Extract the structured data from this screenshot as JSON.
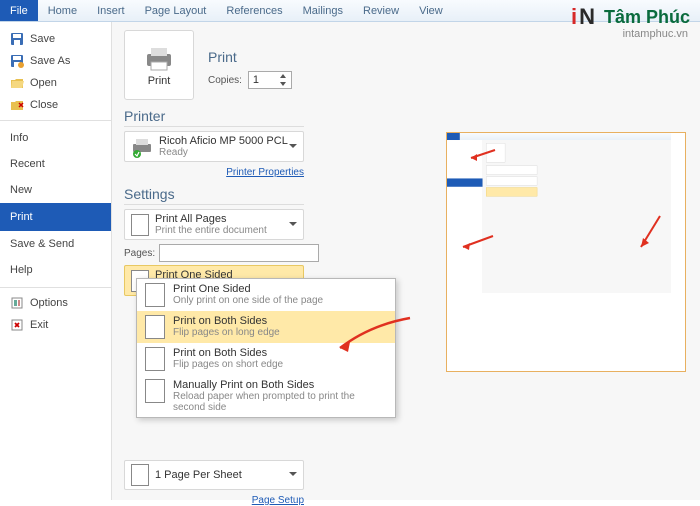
{
  "ribbon": {
    "tabs": [
      "File",
      "Home",
      "Insert",
      "Page Layout",
      "References",
      "Mailings",
      "Review",
      "View"
    ],
    "active": "File"
  },
  "sidebar": {
    "file_items": [
      {
        "icon": "save",
        "label": "Save"
      },
      {
        "icon": "saveas",
        "label": "Save As"
      },
      {
        "icon": "open",
        "label": "Open"
      },
      {
        "icon": "close",
        "label": "Close"
      }
    ],
    "nav_items": [
      "Info",
      "Recent",
      "New",
      "Print",
      "Save & Send",
      "Help"
    ],
    "selected": "Print",
    "bottom": [
      {
        "icon": "options",
        "label": "Options"
      },
      {
        "icon": "exit",
        "label": "Exit"
      }
    ]
  },
  "print": {
    "title": "Print",
    "big_btn": "Print",
    "copies_label": "Copies:",
    "copies_value": "1",
    "printer_header": "Printer",
    "printer_name": "Ricoh Aficio MP 5000 PCL",
    "printer_status": "Ready",
    "printer_props": "Printer Properties",
    "settings_header": "Settings",
    "print_all": {
      "t1": "Print All Pages",
      "t2": "Print the entire document"
    },
    "pages_label": "Pages:",
    "one_sided": {
      "t1": "Print One Sided",
      "t2": "Only print on one side of th..."
    },
    "sheet": {
      "t1": "1 Page Per Sheet"
    },
    "page_setup": "Page Setup"
  },
  "dropdown": {
    "items": [
      {
        "t1": "Print One Sided",
        "t2": "Only print on one side of the page"
      },
      {
        "t1": "Print on Both Sides",
        "t2": "Flip pages on long edge"
      },
      {
        "t1": "Print on Both Sides",
        "t2": "Flip pages on short edge"
      },
      {
        "t1": "Manually Print on Both Sides",
        "t2": "Reload paper when prompted to print the second side"
      }
    ],
    "highlighted": 1
  },
  "logo": {
    "brand": "Tâm Phúc",
    "site": "intamphuc.vn"
  }
}
